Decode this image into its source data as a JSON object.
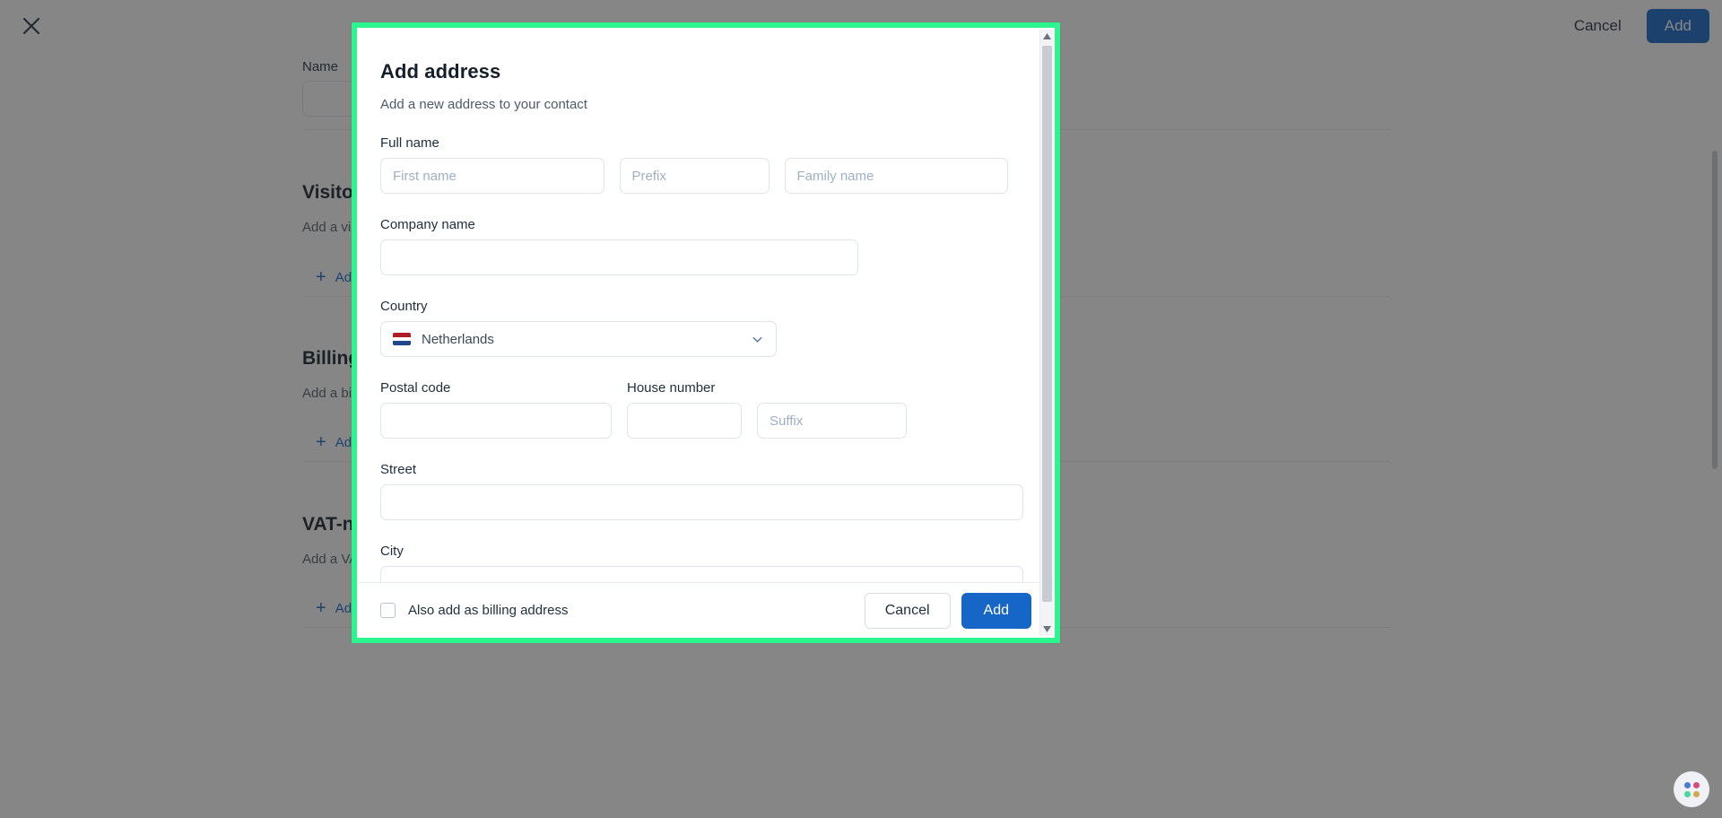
{
  "background": {
    "close_icon": "close-icon",
    "cancel_label": "Cancel",
    "add_label": "Add",
    "name_label": "Name",
    "sections": [
      {
        "heading": "Visitor address",
        "subtext": "Add a visitor address to your contact",
        "add_link": "Add visitor address"
      },
      {
        "heading": "Billing address",
        "subtext": "Add a billing address to your contact",
        "add_link": "Add billing address"
      },
      {
        "heading": "VAT-number",
        "subtext": "Add a VAT-number to your contact",
        "add_link": "Add VAT-number"
      }
    ]
  },
  "modal": {
    "title": "Add address",
    "subtitle": "Add a new address to your contact",
    "fields": {
      "full_name_label": "Full name",
      "first_name_placeholder": "First name",
      "first_name_value": "",
      "prefix_placeholder": "Prefix",
      "prefix_value": "",
      "family_name_placeholder": "Family name",
      "family_name_value": "",
      "company_label": "Company name",
      "company_placeholder": "",
      "company_value": "",
      "country_label": "Country",
      "country_value": "Netherlands",
      "country_flag": "flag-netherlands",
      "chevron_icon": "chevron-down-icon",
      "postal_code_label": "Postal code",
      "postal_code_placeholder": "",
      "postal_code_value": "",
      "house_number_label": "House number",
      "house_number_placeholder": "",
      "house_number_value": "",
      "suffix_placeholder": "Suffix",
      "suffix_value": "",
      "street_label": "Street",
      "street_placeholder": "",
      "street_value": "",
      "city_label": "City",
      "city_placeholder": "",
      "city_value": ""
    },
    "footer": {
      "billing_checkbox_label": "Also add as billing address",
      "billing_checkbox_checked": false,
      "cancel_label": "Cancel",
      "add_label": "Add"
    },
    "scrollbar": {
      "up_arrow_icon": "scroll-up-arrow-icon",
      "down_arrow_icon": "scroll-down-arrow-icon"
    }
  },
  "colors": {
    "highlight_ring": "#2cf58f",
    "primary_button": "#1666c8",
    "link": "#1666c8",
    "border": "#dde4ec",
    "text": "#22313f",
    "placeholder": "#9fb0c3"
  },
  "widget": {
    "icon": "assistant-dots-icon"
  }
}
